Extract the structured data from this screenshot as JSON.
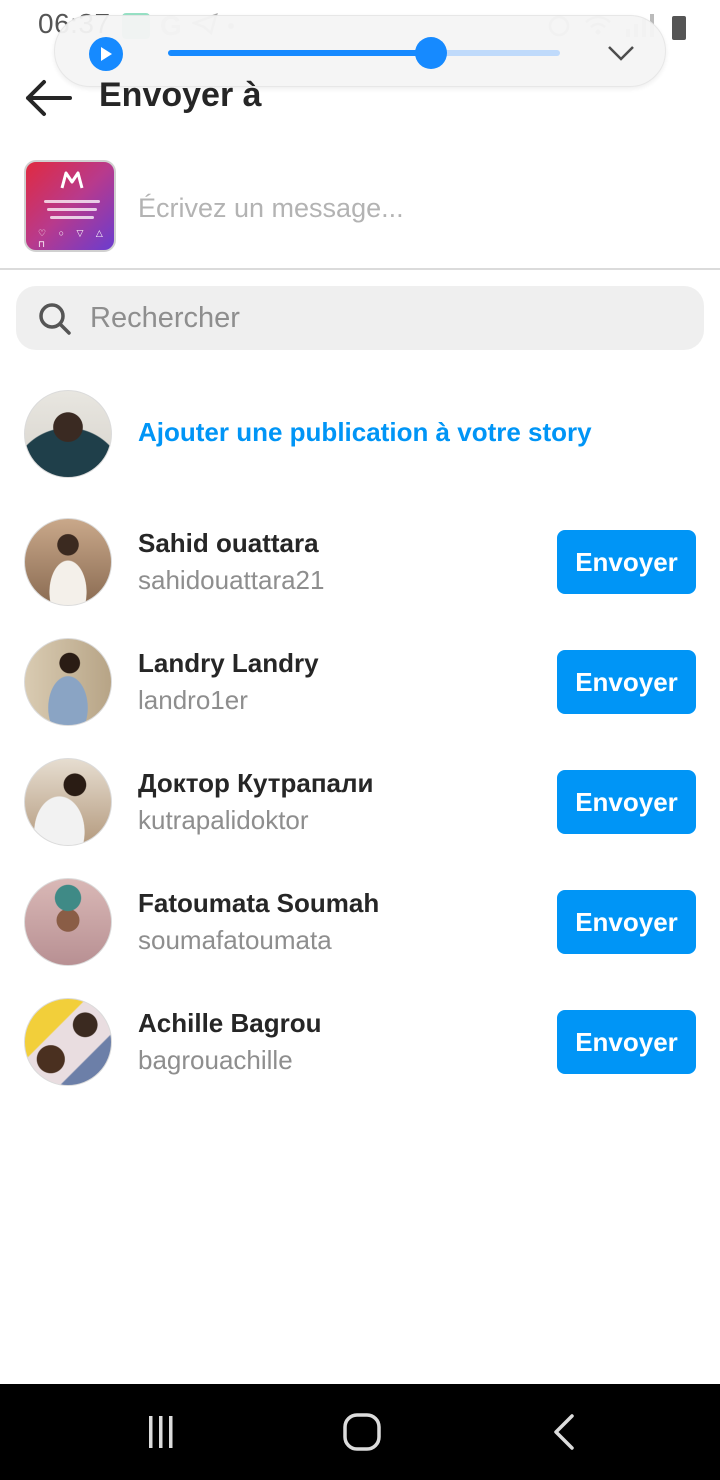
{
  "status_bar": {
    "time": "06:37",
    "left_glyph": "G"
  },
  "media_player": {
    "progress": 0.67
  },
  "header": {
    "title": "Envoyer à"
  },
  "composer": {
    "placeholder": "Écrivez un message..."
  },
  "search": {
    "placeholder": "Rechercher"
  },
  "story": {
    "label": "Ajouter une publication à votre story"
  },
  "recipients": [
    {
      "name": "Sahid ouattara",
      "username": "sahidouattara21",
      "button": "Envoyer"
    },
    {
      "name": "Landry Landry",
      "username": "landro1er",
      "button": "Envoyer"
    },
    {
      "name": "Доктор Кутрапали",
      "username": "kutrapalidoktor",
      "button": "Envoyer"
    },
    {
      "name": "Fatoumata Soumah",
      "username": "soumafatoumata",
      "button": "Envoyer"
    },
    {
      "name": "Achille Bagrou",
      "username": "bagrouachille",
      "button": "Envoyer"
    }
  ],
  "colors": {
    "accent": "#0095f6",
    "player": "#0a84ff",
    "muted_text": "#8e8e8e"
  }
}
